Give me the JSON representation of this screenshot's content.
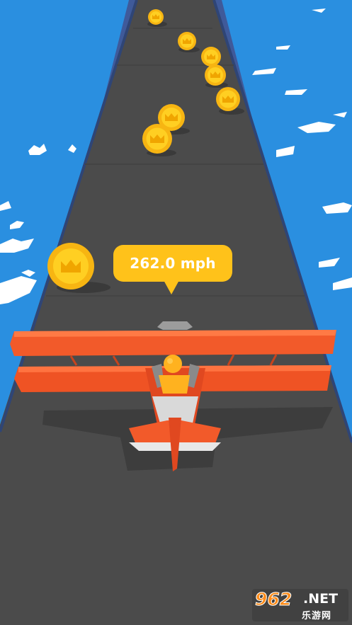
{
  "hud": {
    "speed_label": "262.0 mph"
  },
  "watermark": {
    "number": "962",
    "domain": ".NET",
    "subtitle": "乐游网"
  },
  "colors": {
    "sky": "#2a8fe0",
    "road": "#4b4b4b",
    "rail": "#3f5a9a",
    "coin": "#ffc61a",
    "plane": "#f25a2a",
    "pilot": "#ffb21f",
    "bubble": "#ffc21a"
  },
  "icons": [
    "coin-icon",
    "crown-icon",
    "biplane",
    "pilot"
  ]
}
